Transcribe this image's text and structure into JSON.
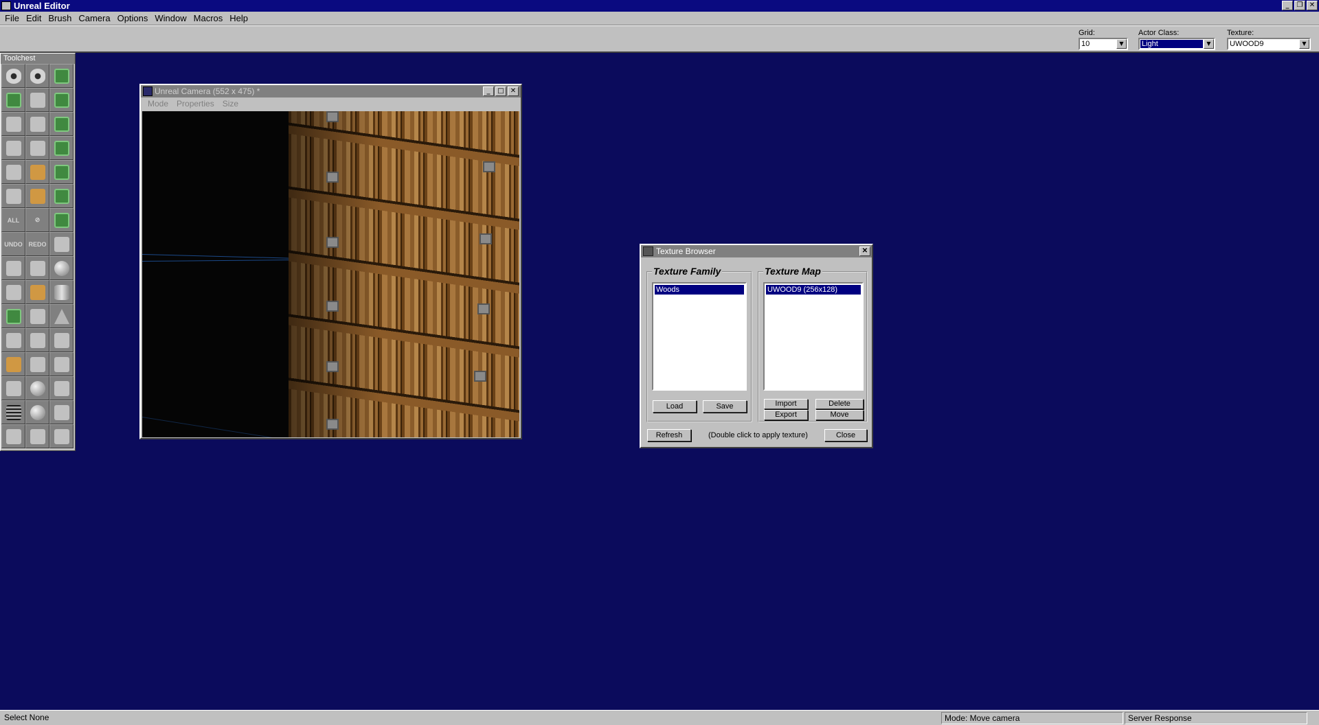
{
  "app": {
    "title": "Unreal Editor"
  },
  "menu": [
    "File",
    "Edit",
    "Brush",
    "Camera",
    "Options",
    "Window",
    "Macros",
    "Help"
  ],
  "toolbar": {
    "grid_label": "Grid:",
    "grid_value": "10",
    "actor_label": "Actor Class:",
    "actor_value": "Light",
    "texture_label": "Texture:",
    "texture_value": "UWOOD9"
  },
  "toolchest": {
    "title": "Toolchest",
    "undo_label": "UNDO",
    "redo_label": "REDO"
  },
  "camera_window": {
    "title": "Unreal Camera (552 x 475) *",
    "menu": [
      "Mode",
      "Properties",
      "Size"
    ]
  },
  "texture_browser": {
    "title": "Texture Browser",
    "family_label": "Texture Family",
    "map_label": "Texture Map",
    "family_items": [
      "Woods"
    ],
    "map_items": [
      "UWOOD9 (256x128)"
    ],
    "load": "Load",
    "save": "Save",
    "import": "Import",
    "export": "Export",
    "delete": "Delete",
    "move": "Move",
    "refresh": "Refresh",
    "hint": "(Double click to apply texture)",
    "close": "Close"
  },
  "status": {
    "left": "Select None",
    "mode": "Mode: Move camera",
    "server": "Server Response"
  },
  "colors": {
    "desktop": "#0b0b5c",
    "titlebar": "#0a0a80",
    "chrome": "#c0c0c0"
  }
}
